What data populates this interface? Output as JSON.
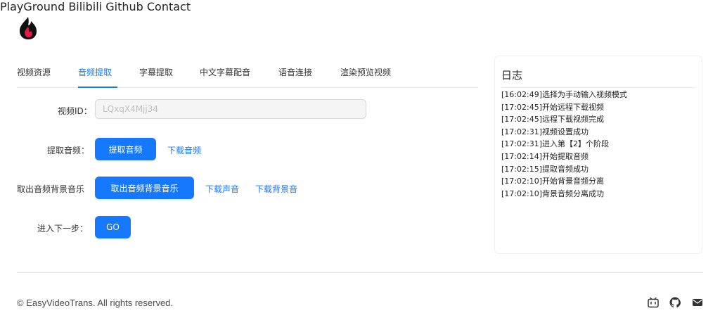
{
  "header": {
    "nav": [
      "PlayGround",
      "Bilibili",
      "Github",
      "Contact"
    ]
  },
  "tabs": [
    "视频资源",
    "音频提取",
    "字幕提取",
    "中文字幕配音",
    "语音连接",
    "渲染预览视频"
  ],
  "active_tab": "音频提取",
  "form": {
    "video_id_label": "视频ID：",
    "video_id_value": "LQxqX4Mjj34",
    "extract_label": "提取音频：",
    "extract_button": "提取音频",
    "download_audio_link": "下载音频",
    "bg_label": "取出音频背景音乐",
    "bg_button": "取出音频背景音乐",
    "download_voice_link": "下载声音",
    "download_bg_link": "下载背景音",
    "next_label": "进入下一步：",
    "go_button": "GO"
  },
  "log": {
    "title": "日志",
    "lines": [
      "[16:02:49]选择为手动输入视频模式",
      "[17:02:45]开始远程下载视频",
      "[17:02:45]远程下载视频完成",
      "[17:02:31]视频设置成功",
      "[17:02:31]进入第【2】个阶段",
      "[17:02:14]开始提取音频",
      "[17:02:15]提取音频成功",
      "[17:02:10]开始背景音频分离",
      "[17:02:10]背景音频分离成功"
    ]
  },
  "footer": {
    "copyright": "© EasyVideoTrans. All rights reserved.",
    "icons": [
      "bilibili-icon",
      "github-icon",
      "mail-icon"
    ]
  },
  "colors": {
    "accent": "#1677ff",
    "logo_red": "#e6194b",
    "logo_dark": "#111111"
  }
}
